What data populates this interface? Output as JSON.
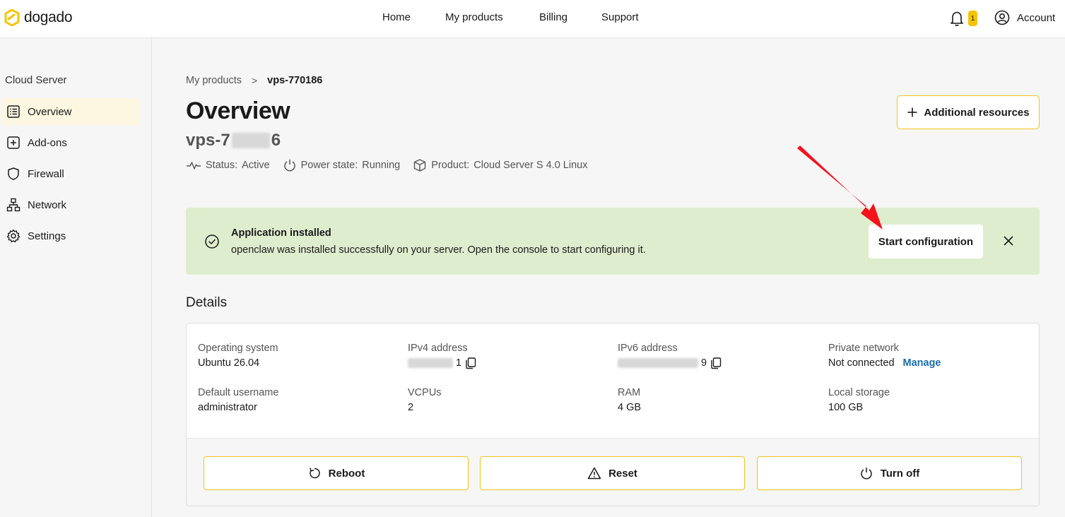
{
  "brand": {
    "name": "dogado",
    "accent": "#f5c400"
  },
  "nav": {
    "home": "Home",
    "my_products": "My products",
    "billing": "Billing",
    "support": "Support"
  },
  "notifications": {
    "count": "1"
  },
  "account": {
    "label": "Account"
  },
  "sidebar": {
    "title": "Cloud Server",
    "items": [
      {
        "label": "Overview",
        "icon": "list-icon",
        "active": true
      },
      {
        "label": "Add-ons",
        "icon": "plus-square-icon"
      },
      {
        "label": "Firewall",
        "icon": "shield-icon"
      },
      {
        "label": "Network",
        "icon": "network-icon"
      },
      {
        "label": "Settings",
        "icon": "gear-icon"
      }
    ]
  },
  "breadcrumb": {
    "parent": "My products",
    "separator": ">",
    "current": "vps-770186"
  },
  "page": {
    "title": "Overview",
    "server_name_prefix": "vps-7",
    "server_name_suffix": "6",
    "status_label": "Status:",
    "status_value": "Active",
    "power_label": "Power state:",
    "power_value": "Running",
    "product_label": "Product:",
    "product_value": "Cloud Server S 4.0 Linux",
    "additional_resources": "Additional resources"
  },
  "banner": {
    "title": "Application installed",
    "text": "openclaw was installed successfully on your server. Open the console to start configuring it.",
    "button": "Start configuration",
    "color": "#dfedcf"
  },
  "details": {
    "title": "Details",
    "os_label": "Operating system",
    "os_value": "Ubuntu 26.04",
    "ipv4_label": "IPv4 address",
    "ipv4_suffix": "1",
    "ipv6_label": "IPv6 address",
    "ipv6_suffix": "9",
    "private_label": "Private network",
    "private_value": "Not connected",
    "manage": "Manage",
    "username_label": "Default username",
    "username_value": "administrator",
    "vcpu_label": "VCPUs",
    "vcpu_value": "2",
    "ram_label": "RAM",
    "ram_value": "4 GB",
    "storage_label": "Local storage",
    "storage_value": "100 GB"
  },
  "actions": {
    "reboot": "Reboot",
    "reset": "Reset",
    "turn_off": "Turn off"
  }
}
